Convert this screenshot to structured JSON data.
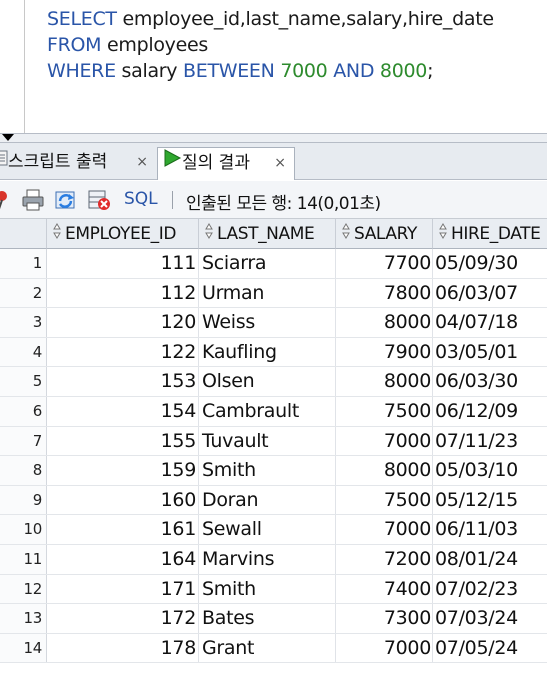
{
  "editor": {
    "line1": {
      "kw": "SELECT",
      "rest": " employee_id,last_name,salary,hire_date"
    },
    "line2": {
      "kw": "FROM",
      "rest": " employees"
    },
    "line3": {
      "kw1": "WHERE",
      "mid1": " salary ",
      "kw2": "BETWEEN",
      "sp1": " ",
      "num1": "7000",
      "sp2": " ",
      "kw3": "AND",
      "sp3": " ",
      "num2": "8000",
      "end": ";"
    }
  },
  "tabs": [
    {
      "label": "스크립트 출력",
      "close": "×",
      "icon": "script-output-icon"
    },
    {
      "label": "질의 결과",
      "close": "×",
      "icon": "play-icon",
      "active": true
    }
  ],
  "toolbar": {
    "icons": [
      "pin-icon",
      "print-icon",
      "refresh-icon",
      "cancel-icon"
    ],
    "sql_label": "SQL",
    "status": "인출된 모든 행: 14(0,01초)"
  },
  "grid": {
    "columns": [
      "EMPLOYEE_ID",
      "LAST_NAME",
      "SALARY",
      "HIRE_DATE"
    ],
    "rows": [
      {
        "n": "1",
        "id": "111",
        "last_name": "Sciarra",
        "salary": "7700",
        "hire_date": "05/09/30"
      },
      {
        "n": "2",
        "id": "112",
        "last_name": "Urman",
        "salary": "7800",
        "hire_date": "06/03/07"
      },
      {
        "n": "3",
        "id": "120",
        "last_name": "Weiss",
        "salary": "8000",
        "hire_date": "04/07/18"
      },
      {
        "n": "4",
        "id": "122",
        "last_name": "Kaufling",
        "salary": "7900",
        "hire_date": "03/05/01"
      },
      {
        "n": "5",
        "id": "153",
        "last_name": "Olsen",
        "salary": "8000",
        "hire_date": "06/03/30"
      },
      {
        "n": "6",
        "id": "154",
        "last_name": "Cambrault",
        "salary": "7500",
        "hire_date": "06/12/09"
      },
      {
        "n": "7",
        "id": "155",
        "last_name": "Tuvault",
        "salary": "7000",
        "hire_date": "07/11/23"
      },
      {
        "n": "8",
        "id": "159",
        "last_name": "Smith",
        "salary": "8000",
        "hire_date": "05/03/10"
      },
      {
        "n": "9",
        "id": "160",
        "last_name": "Doran",
        "salary": "7500",
        "hire_date": "05/12/15"
      },
      {
        "n": "10",
        "id": "161",
        "last_name": "Sewall",
        "salary": "7000",
        "hire_date": "06/11/03"
      },
      {
        "n": "11",
        "id": "164",
        "last_name": "Marvins",
        "salary": "7200",
        "hire_date": "08/01/24"
      },
      {
        "n": "12",
        "id": "171",
        "last_name": "Smith",
        "salary": "7400",
        "hire_date": "07/02/23"
      },
      {
        "n": "13",
        "id": "172",
        "last_name": "Bates",
        "salary": "7300",
        "hire_date": "07/03/24"
      },
      {
        "n": "14",
        "id": "178",
        "last_name": "Grant",
        "salary": "7000",
        "hire_date": "07/05/24"
      }
    ]
  }
}
